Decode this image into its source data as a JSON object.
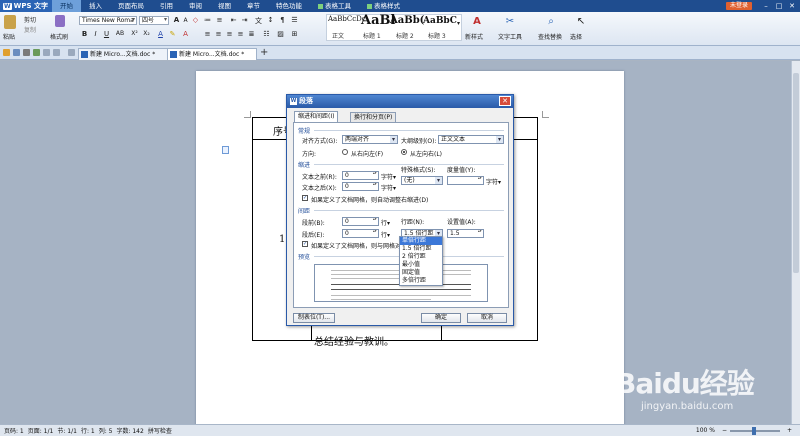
{
  "titlebar": {
    "app_name": "WPS 文字",
    "menus": [
      "开始",
      "插入",
      "页面布局",
      "引用",
      "审阅",
      "视图",
      "章节",
      "特色功能"
    ],
    "context_tabs": [
      "表格工具",
      "表格样式"
    ],
    "login": "未登录"
  },
  "ribbon": {
    "paste": "粘贴",
    "cut": "剪切",
    "copy": "复制",
    "format_painter": "格式刷",
    "font_name": "Times New Roma",
    "font_size": "四号",
    "styles": [
      {
        "sample": "AaBbCcDc",
        "name": "正文"
      },
      {
        "sample": "AaBl",
        "name": "标题 1"
      },
      {
        "sample": "AaBb(",
        "name": "标题 2"
      },
      {
        "sample": "AaBbC",
        "name": "标题 3"
      }
    ],
    "new_style": "新样式",
    "text_tools": "文字工具",
    "find_replace": "查找替换",
    "select": "选择"
  },
  "tabs": [
    {
      "label": "新建 Micro...文档.doc *",
      "active": false
    },
    {
      "label": "新建 Micro...文档.doc *",
      "active": true
    }
  ],
  "document": {
    "cell_label": "序号",
    "row_number": "1",
    "cell_text": "总结经验与教训。"
  },
  "dialog": {
    "title": "段落",
    "tabs": [
      "缩进和间距(I)",
      "换行和分页(P)"
    ],
    "general": {
      "section": "常规",
      "alignment_label": "对齐方式(G):",
      "alignment_value": "两端对齐",
      "outline_label": "大纲级别(O):",
      "outline_value": "正文文本",
      "direction_label": "方向:",
      "rtl": "从右向左(F)",
      "ltr": "从左向右(L)"
    },
    "indent": {
      "section": "缩进",
      "before_label": "文本之前(R):",
      "before_value": "0",
      "before_unit": "字符▾",
      "after_label": "文本之后(X):",
      "after_value": "0",
      "after_unit": "字符▾",
      "special_label": "特殊格式(S):",
      "special_value": "(无)",
      "measure_label": "度量值(Y):",
      "measure_value": "",
      "measure_unit": "字符▾",
      "grid_check": "如果定义了文档网格，则自动调整右缩进(D)"
    },
    "spacing": {
      "section": "间距",
      "before_label": "段前(B):",
      "before_value": "0",
      "before_unit": "行▾",
      "after_label": "段后(E):",
      "after_value": "0",
      "after_unit": "行▾",
      "line_label": "行距(N):",
      "line_value": "1.5 倍行距",
      "set_label": "设置值(A):",
      "set_value": "1.5",
      "grid_check": "如果定义了文档网格，则与网格对齐(W)"
    },
    "preview_section": "预览",
    "line_spacing_options": [
      "单倍行距",
      "1.5 倍行距",
      "2 倍行距",
      "最小值",
      "固定值",
      "多倍行距"
    ],
    "selected_option": "单倍行距",
    "tabs_button": "制表位(T)...",
    "ok": "确定",
    "cancel": "取消"
  },
  "status": {
    "items": [
      "页码: 1",
      "页面: 1/1",
      "节: 1/1",
      "行: 1",
      "列: 5",
      "字数: 142",
      "拼写检查"
    ],
    "zoom": "100 %"
  },
  "watermark": {
    "brand": "Baidu经验",
    "url": "jingyan.baidu.com"
  },
  "colors": {
    "title_bar": "#1f4d8f",
    "dialog_title": "#2a5aa8",
    "login_button": "#e06030",
    "selection": "#3c78d8"
  }
}
